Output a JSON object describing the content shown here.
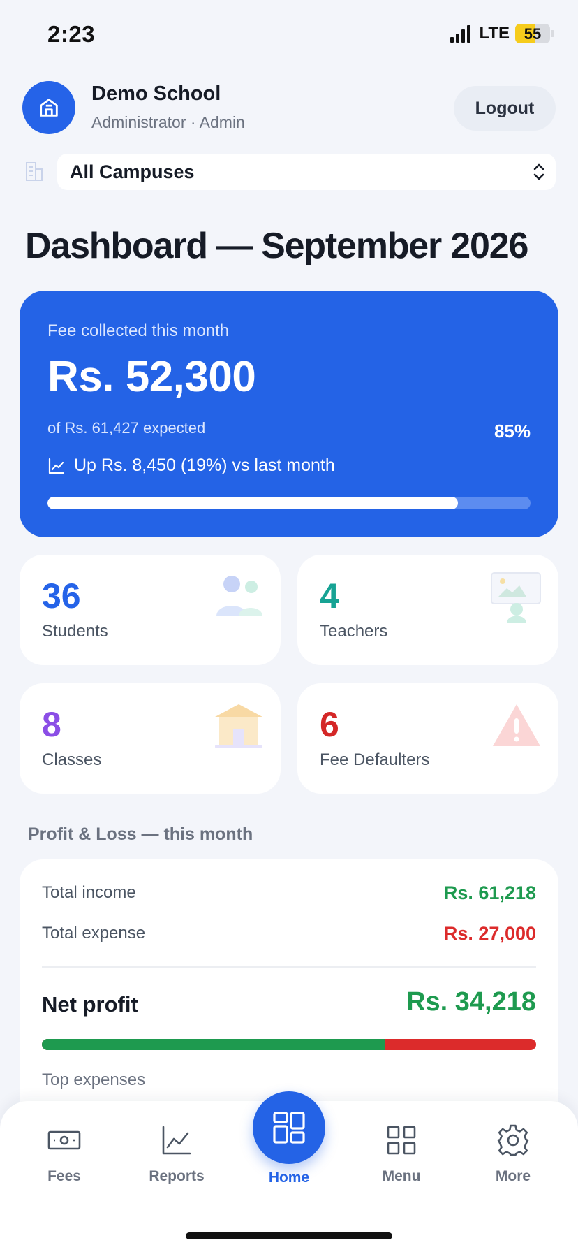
{
  "status_bar": {
    "time": "2:23",
    "network": "LTE",
    "battery": "55",
    "battery_level": 0.55
  },
  "header": {
    "school_name": "Demo School",
    "role": "Administrator · Admin",
    "logout_label": "Logout"
  },
  "campus": {
    "selected": "All Campuses"
  },
  "page_title": "Dashboard — September 2026",
  "fee_card": {
    "label": "Fee collected this month",
    "amount": "Rs. 52,300",
    "expected": "of Rs. 61,427 expected",
    "percent": "85%",
    "progress": 0.85,
    "trend": "Up Rs. 8,450 (19%) vs last month"
  },
  "stats": [
    {
      "value": "36",
      "label": "Students",
      "color": "#2563e8"
    },
    {
      "value": "4",
      "label": "Teachers",
      "color": "#17a394"
    },
    {
      "value": "8",
      "label": "Classes",
      "color": "#8b4ee6"
    },
    {
      "value": "6",
      "label": "Fee Defaulters",
      "color": "#d42727"
    }
  ],
  "profit_loss": {
    "heading": "Profit & Loss — this month",
    "income_label": "Total income",
    "income_value": "Rs. 61,218",
    "expense_label": "Total expense",
    "expense_value": "Rs. 27,000",
    "net_label": "Net profit",
    "net_value": "Rs. 34,218",
    "income_share": 0.694,
    "top_expenses_label": "Top expenses"
  },
  "nav": {
    "fees": "Fees",
    "reports": "Reports",
    "home": "Home",
    "menu": "Menu",
    "more": "More"
  },
  "colors": {
    "primary": "#2463e6",
    "positive": "#1e9a4f",
    "negative": "#dc2b2b"
  }
}
